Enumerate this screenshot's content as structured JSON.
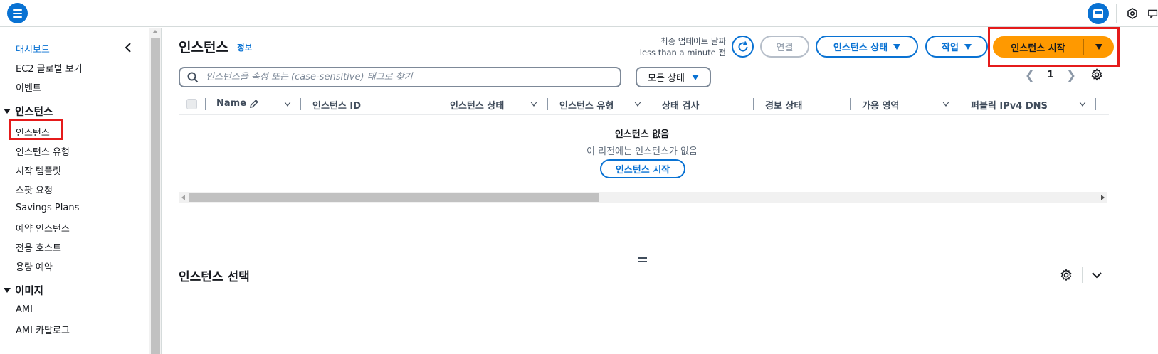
{
  "sidebar": {
    "items": [
      {
        "label": "대시보드"
      },
      {
        "label": "EC2 글로벌 보기"
      },
      {
        "label": "이벤트"
      }
    ],
    "sections": [
      {
        "title": "인스턴스",
        "items": [
          {
            "label": "인스턴스"
          },
          {
            "label": "인스턴스 유형"
          },
          {
            "label": "시작 템플릿"
          },
          {
            "label": "스팟 요청"
          },
          {
            "label": "Savings Plans"
          },
          {
            "label": "예약 인스턴스"
          },
          {
            "label": "전용 호스트"
          },
          {
            "label": "용량 예약"
          }
        ]
      },
      {
        "title": "이미지",
        "items": [
          {
            "label": "AMI"
          },
          {
            "label": "AMI 카탈로그"
          }
        ]
      }
    ]
  },
  "header": {
    "title": "인스턴스",
    "info_link": "정보",
    "last_updated_label": "최종 업데이트 날짜",
    "last_updated_value": "less than a minute 전",
    "connect_label": "연결",
    "instance_state_label": "인스턴스 상태",
    "actions_label": "작업",
    "launch_label": "인스턴스 시작"
  },
  "filter": {
    "search_placeholder": "인스턴스을 속성 또는 (case-sensitive) 태그로 찾기",
    "state_filter_label": "모든 상태"
  },
  "pagination": {
    "current_page": "1"
  },
  "table": {
    "columns": [
      {
        "label": "Name"
      },
      {
        "label": "인스턴스 ID"
      },
      {
        "label": "인스턴스 상태"
      },
      {
        "label": "인스턴스 유형"
      },
      {
        "label": "상태 검사"
      },
      {
        "label": "경보 상태"
      },
      {
        "label": "가용 영역"
      },
      {
        "label": "퍼블릭 IPv4 DNS"
      }
    ],
    "empty_title": "인스턴스 없음",
    "empty_message": "이 리전에는 인스턴스가 없음",
    "empty_launch_label": "인스턴스 시작"
  },
  "details": {
    "title": "인스턴스 선택"
  },
  "colors": {
    "link": "#0972d3",
    "primary_button": "#ff9900",
    "highlight": "#e51b1b"
  }
}
